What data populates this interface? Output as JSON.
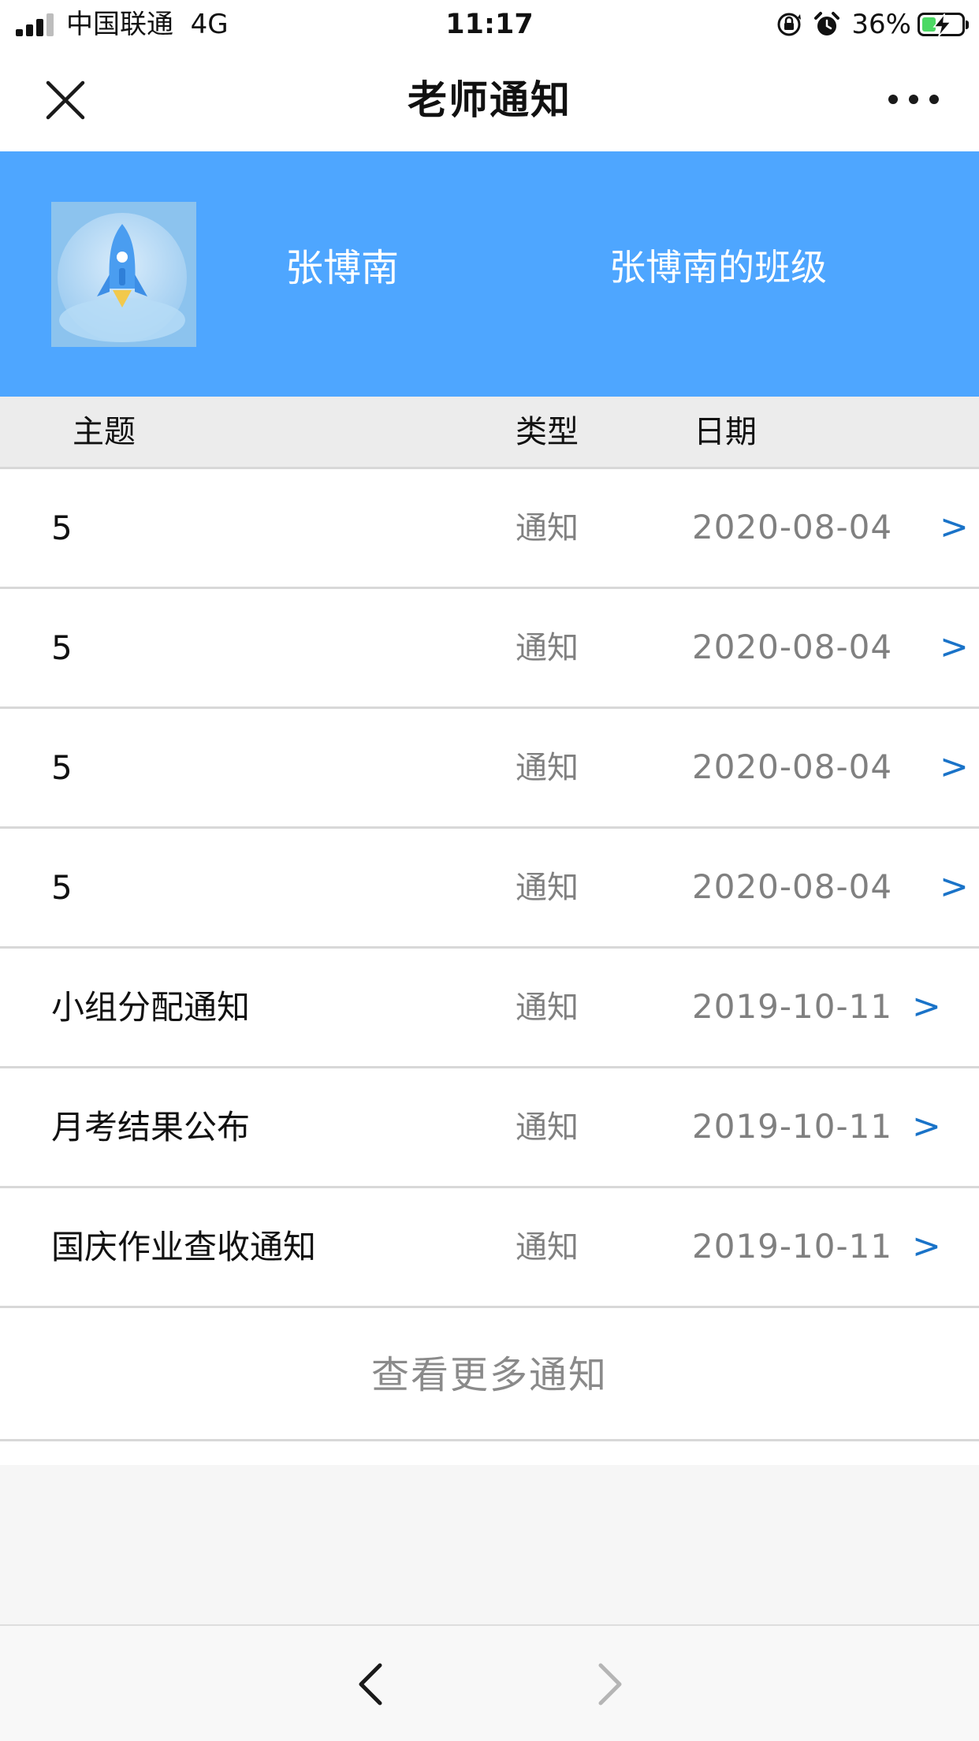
{
  "status_bar": {
    "carrier": "中国联通",
    "network": "4G",
    "time": "11:17",
    "battery_percent": "36%",
    "battery_level": 0.36,
    "icons": [
      "signal-icon",
      "rotation-lock-icon",
      "alarm-icon",
      "battery-icon"
    ]
  },
  "nav": {
    "title": "老师通知",
    "close_icon": "close-icon",
    "more_icon": "more-icon"
  },
  "banner": {
    "name": "张博南",
    "class_name": "张博南的班级",
    "avatar_icon": "rocket-icon",
    "color": "#4ea6ff"
  },
  "table": {
    "headers": {
      "subject": "主题",
      "type": "类型",
      "date": "日期"
    },
    "rows": [
      {
        "subject": "5",
        "type": "通知",
        "date": "2020-08-04",
        "arrow": ">"
      },
      {
        "subject": "5",
        "type": "通知",
        "date": "2020-08-04",
        "arrow": ">"
      },
      {
        "subject": "5",
        "type": "通知",
        "date": "2020-08-04",
        "arrow": ">"
      },
      {
        "subject": "5",
        "type": "通知",
        "date": "2020-08-04",
        "arrow": ">"
      },
      {
        "subject": "小组分配通知",
        "type": "通知",
        "date": "2019-10-11",
        "arrow": ">"
      },
      {
        "subject": "月考结果公布",
        "type": "通知",
        "date": "2019-10-11",
        "arrow": ">"
      },
      {
        "subject": "国庆作业查收通知",
        "type": "通知",
        "date": "2019-10-11",
        "arrow": ">"
      }
    ],
    "arrow_color": "#1a73c8"
  },
  "more_link": "查看更多通知",
  "toolbar": {
    "back_icon": "chevron-left-icon",
    "forward_icon": "chevron-right-icon"
  }
}
